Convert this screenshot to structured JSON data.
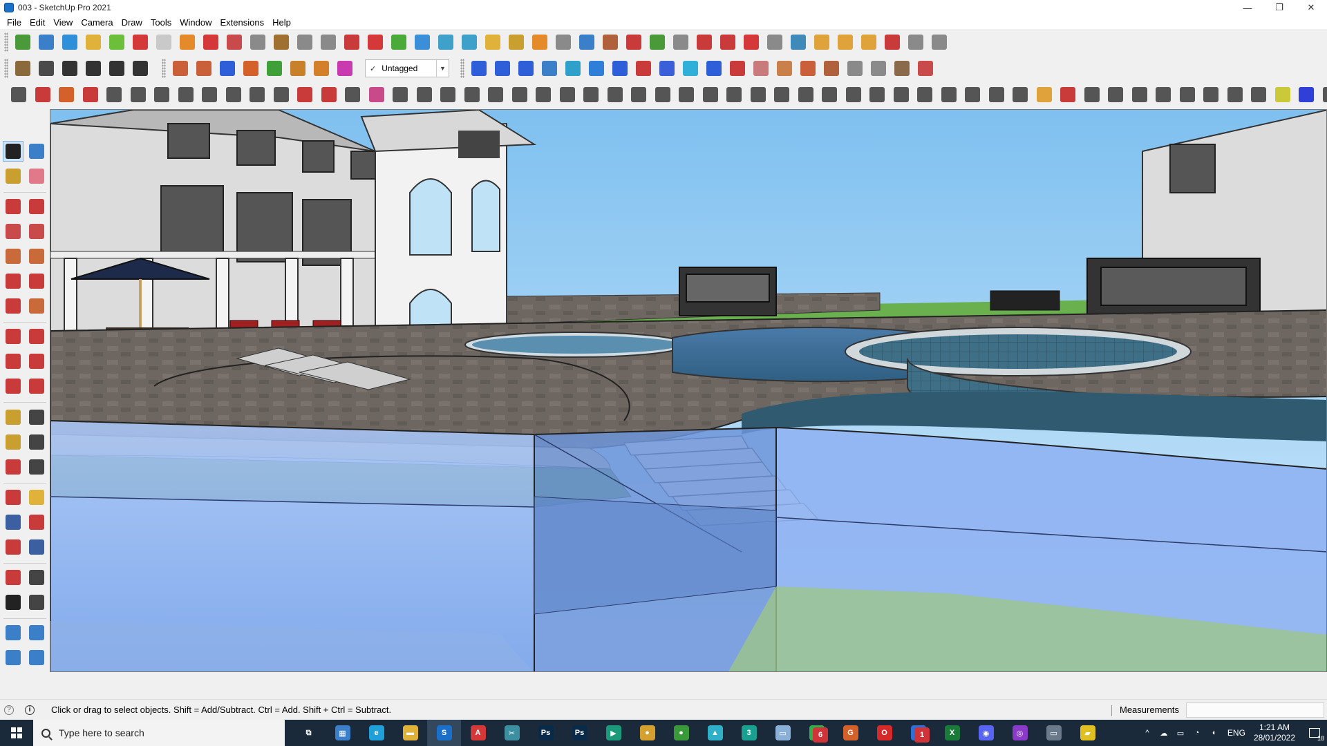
{
  "window": {
    "title": "003 - SketchUp Pro 2021",
    "controls": [
      "—",
      "❐",
      "✕"
    ]
  },
  "menu": [
    "File",
    "Edit",
    "View",
    "Camera",
    "Draw",
    "Tools",
    "Window",
    "Extensions",
    "Help"
  ],
  "tag_dropdown": {
    "selected": "Untagged",
    "check": "✓",
    "arrow": "▼"
  },
  "toolbar_row1": {
    "icons": [
      "#4a9a3a",
      "#3b7fc9",
      "#2f8fd8",
      "#e0b23a",
      "#6bbf3a",
      "#d43838",
      "#c9c9c9",
      "#e58a2a",
      "#d43838",
      "#c94a4a",
      "#8a8a8a",
      "#a07030",
      "#8a8a8a",
      "#8a8a8a",
      "#c93a3a",
      "#d43838",
      "#4aab3a",
      "#3b8fd8",
      "#3fa0c9",
      "#3fa0c9",
      "#e0b23a",
      "#c9a030",
      "#e58a2a",
      "#8a8a8a",
      "#3b7fc9",
      "#b0603a",
      "#c93a3a",
      "#4a9a3a",
      "#8a8a8a",
      "#c93a3a",
      "#c93a3a",
      "#d43838",
      "#8a8a8a",
      "#3f8ab8",
      "#e0a23a",
      "#e0a23a",
      "#e0a23a",
      "#c93a3a",
      "#8a8a8a",
      "#8a8a8a"
    ]
  },
  "toolbar_row2": {
    "left_icons": [
      "#8a6a3a",
      "#4a4a4a",
      "#333333",
      "#333333",
      "#333333",
      "#333333"
    ],
    "push_icons": [
      "#c9603a",
      "#c9603a",
      "#2f5fd8",
      "#d4602a",
      "#3fa03a",
      "#c9802a",
      "#d4802a",
      "#c93ab0"
    ],
    "right_icons": [
      "#2f5fd8",
      "#2f5fd8",
      "#2f5fd8",
      "#3b7fc9",
      "#2fa0c9",
      "#2f7fd8",
      "#2f5fd8",
      "#c93a3a",
      "#3b5fd8",
      "#2fb0d8",
      "#2f5fd8",
      "#c93a3a",
      "#c97a7a",
      "#c9804a",
      "#c9603a",
      "#b0603a",
      "#8a8a8a",
      "#8a8a8a",
      "#8a6a4a",
      "#c94a4a"
    ]
  },
  "toolbar_row3": {
    "icons": [
      "#555555",
      "#c93a3a",
      "#d4602a",
      "#c93a3a",
      "#555555",
      "#555555",
      "#555555",
      "#555555",
      "#555555",
      "#555555",
      "#555555",
      "#555555",
      "#c93a3a",
      "#c93a3a",
      "#555555",
      "#c94a8a",
      "#555555",
      "#555555",
      "#555555",
      "#555555",
      "#555555",
      "#555555",
      "#555555",
      "#555555",
      "#555555",
      "#555555",
      "#555555",
      "#555555",
      "#555555",
      "#555555",
      "#555555",
      "#555555",
      "#555555",
      "#555555",
      "#555555",
      "#555555",
      "#555555",
      "#555555",
      "#555555",
      "#555555",
      "#555555",
      "#555555",
      "#555555",
      "#e0a23a",
      "#c93a3a",
      "#555555",
      "#555555",
      "#555555",
      "#555555",
      "#555555",
      "#555555",
      "#555555",
      "#555555",
      "#c9c93a",
      "#2f3fd8",
      "#555555",
      "#c93a3a",
      "#c94a8a"
    ]
  },
  "left_tools": [
    [
      {
        "name": "select-tool-icon",
        "color": "#222222",
        "active": true
      },
      {
        "name": "component-tool-icon",
        "color": "#3b7fc9"
      }
    ],
    [
      {
        "name": "paint-bucket-icon",
        "color": "#c9a030"
      },
      {
        "name": "eraser-icon",
        "color": "#e07a8a"
      }
    ],
    [
      {
        "name": "line-tool-icon",
        "color": "#c93a3a"
      },
      {
        "name": "freehand-tool-icon",
        "color": "#c93a3a"
      }
    ],
    [
      {
        "name": "rectangle-tool-icon",
        "color": "#c94a4a"
      },
      {
        "name": "rotated-rectangle-icon",
        "color": "#c94a4a"
      }
    ],
    [
      {
        "name": "circle-tool-icon",
        "color": "#c96a3a"
      },
      {
        "name": "polygon-tool-icon",
        "color": "#c96a3a"
      }
    ],
    [
      {
        "name": "arc-tool-icon",
        "color": "#c93a3a"
      },
      {
        "name": "two-point-arc-icon",
        "color": "#c93a3a"
      }
    ],
    [
      {
        "name": "three-point-arc-icon",
        "color": "#c93a3a"
      },
      {
        "name": "pie-tool-icon",
        "color": "#c96a3a"
      }
    ],
    [
      {
        "name": "move-tool-icon",
        "color": "#c93a3a"
      },
      {
        "name": "push-pull-icon",
        "color": "#c93a3a"
      }
    ],
    [
      {
        "name": "rotate-tool-icon",
        "color": "#c93a3a"
      },
      {
        "name": "follow-me-icon",
        "color": "#c93a3a"
      }
    ],
    [
      {
        "name": "scale-tool-icon",
        "color": "#c93a3a"
      },
      {
        "name": "offset-tool-icon",
        "color": "#c93a3a"
      }
    ],
    [
      {
        "name": "tape-measure-icon",
        "color": "#c9a030"
      },
      {
        "name": "dimension-tool-icon",
        "color": "#444444"
      }
    ],
    [
      {
        "name": "protractor-icon",
        "color": "#c9a030"
      },
      {
        "name": "text-tool-icon",
        "color": "#444444"
      }
    ],
    [
      {
        "name": "axes-tool-icon",
        "color": "#c93a3a"
      },
      {
        "name": "3d-text-icon",
        "color": "#444444"
      }
    ],
    [
      {
        "name": "orbit-tool-icon",
        "color": "#c93a3a"
      },
      {
        "name": "pan-tool-icon",
        "color": "#e0b23a"
      }
    ],
    [
      {
        "name": "zoom-tool-icon",
        "color": "#3b5fa0"
      },
      {
        "name": "zoom-window-icon",
        "color": "#c93a3a"
      }
    ],
    [
      {
        "name": "zoom-extents-icon",
        "color": "#c93a3a"
      },
      {
        "name": "previous-view-icon",
        "color": "#3b5fa0"
      }
    ],
    [
      {
        "name": "position-camera-icon",
        "color": "#c93a3a"
      },
      {
        "name": "look-around-icon",
        "color": "#444444"
      }
    ],
    [
      {
        "name": "walk-tool-icon",
        "color": "#222222"
      },
      {
        "name": "section-plane-icon",
        "color": "#444444"
      }
    ],
    [
      {
        "name": "sandbox-from-contours-icon",
        "color": "#3b7fc9"
      },
      {
        "name": "sandbox-from-scratch-icon",
        "color": "#3b7fc9"
      }
    ],
    [
      {
        "name": "smoove-tool-icon",
        "color": "#3b7fc9"
      },
      {
        "name": "stamp-tool-icon",
        "color": "#3b7fc9"
      }
    ]
  ],
  "status": {
    "message": "Click or drag to select objects. Shift = Add/Subtract. Ctrl = Add. Shift + Ctrl = Subtract.",
    "measurements_label": "Measurements",
    "info_glyph": "i",
    "geo_glyph": "?"
  },
  "taskbar": {
    "search_placeholder": "Type here to search",
    "apps": [
      {
        "name": "task-view-icon",
        "color": "#1b2a3a",
        "label": "⧉"
      },
      {
        "name": "calculator-icon",
        "color": "#3b7fc9",
        "label": "▦"
      },
      {
        "name": "edge-icon",
        "color": "#1fa0d8",
        "label": "e"
      },
      {
        "name": "file-explorer-icon",
        "color": "#e0b23a",
        "label": "▬"
      },
      {
        "name": "sketchup-taskbar-icon",
        "color": "#1a6fc9",
        "label": "S",
        "active": true
      },
      {
        "name": "acrobat-icon",
        "color": "#d43838",
        "label": "A"
      },
      {
        "name": "snipping-icon",
        "color": "#3b8fa0",
        "label": "✂"
      },
      {
        "name": "photoshop-icon-1",
        "color": "#0a2a4a",
        "label": "Ps"
      },
      {
        "name": "photoshop-icon-2",
        "color": "#0a2a4a",
        "label": "Ps"
      },
      {
        "name": "enscape-icon",
        "color": "#1a9a7a",
        "label": "▶"
      },
      {
        "name": "chrome-icon-1",
        "color": "#d4a030",
        "label": "●"
      },
      {
        "name": "chrome-icon-2",
        "color": "#3a9a3a",
        "label": "●"
      },
      {
        "name": "sketchup-viewer-icon",
        "color": "#2fb0c9",
        "label": "▲"
      },
      {
        "name": "app-3-icon",
        "color": "#1aa090",
        "label": "3"
      },
      {
        "name": "notes-icon",
        "color": "#8ab0d8",
        "label": "▭"
      },
      {
        "name": "whatsapp-icon",
        "color": "#2fb04a",
        "label": "✆",
        "badge": "6"
      },
      {
        "name": "grammarly-icon",
        "color": "#d4602a",
        "label": "G"
      },
      {
        "name": "opera-icon",
        "color": "#d42a2a",
        "label": "O"
      },
      {
        "name": "todo-icon",
        "color": "#2f6fd8",
        "label": "✔",
        "badge": "1"
      },
      {
        "name": "excel-icon",
        "color": "#1a7a3a",
        "label": "X"
      },
      {
        "name": "discord-icon",
        "color": "#5865f2",
        "label": "◉"
      },
      {
        "name": "podcast-icon",
        "color": "#8a3ac9",
        "label": "◎"
      },
      {
        "name": "window-app-icon",
        "color": "#6a7a8a",
        "label": "▭"
      },
      {
        "name": "sticky-notes-icon",
        "color": "#e0c020",
        "label": "▰"
      }
    ],
    "tray": {
      "chevron": "^",
      "lang": "ENG",
      "time": "1:21 AM",
      "date": "28/01/2022",
      "notif_count": "18"
    }
  },
  "colors": {
    "sky": "#a8d4f5",
    "water_wall": "#8ab4f0",
    "deck": "#6b6560",
    "grass": "#5aa04a"
  }
}
